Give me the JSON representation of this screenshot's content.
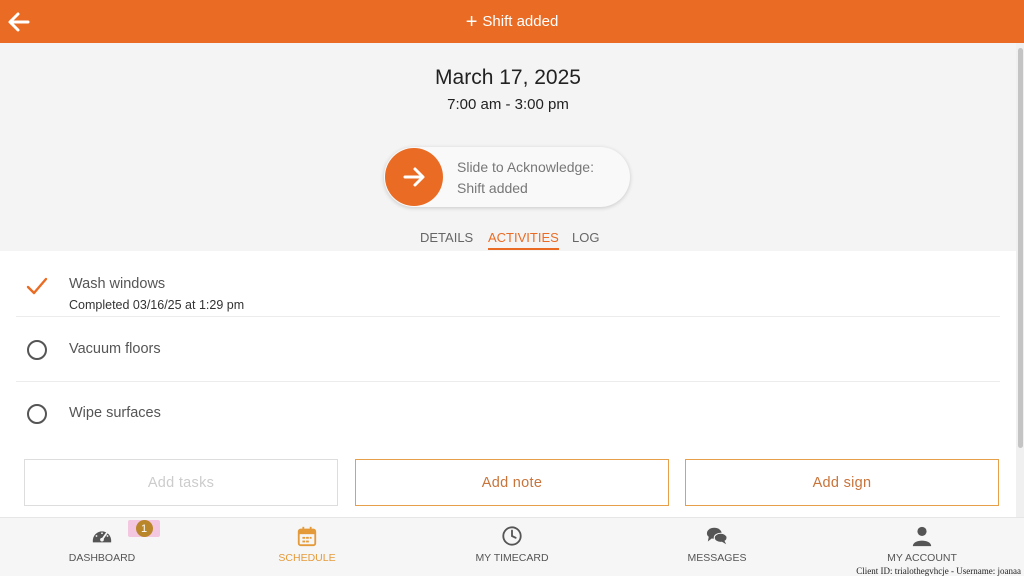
{
  "header": {
    "title": "Shift added",
    "plus_glyph": "+",
    "back_icon": "arrow-left-icon"
  },
  "shift": {
    "date": "March 17, 2025",
    "time": "7:00 am - 3:00 pm"
  },
  "slider": {
    "line1": "Slide to Acknowledge:",
    "line2": "Shift added",
    "icon": "arrow-right-icon"
  },
  "tabs": [
    {
      "label": "DETAILS",
      "active": false
    },
    {
      "label": "ACTIVITIES",
      "active": true
    },
    {
      "label": "LOG",
      "active": false
    }
  ],
  "activities": [
    {
      "title": "Wash windows",
      "subtitle": "Completed 03/16/25 at 1:29 pm",
      "done": true,
      "icon": "checkmark-icon"
    },
    {
      "title": "Vacuum floors",
      "subtitle": "",
      "done": false,
      "icon": "radio-circle-icon"
    },
    {
      "title": "Wipe surfaces",
      "subtitle": "",
      "done": false,
      "icon": "radio-circle-icon"
    }
  ],
  "buttons": {
    "add_tasks": "Add tasks",
    "add_note": "Add note",
    "add_sign": "Add sign"
  },
  "nav": [
    {
      "label": "DASHBOARD",
      "icon": "speedometer-icon",
      "active": false
    },
    {
      "label": "SCHEDULE",
      "icon": "calendar-icon",
      "active": true
    },
    {
      "label": "MY TIMECARD",
      "icon": "clock-icon",
      "active": false
    },
    {
      "label": "MESSAGES",
      "icon": "chat-bubbles-icon",
      "active": false
    },
    {
      "label": "MY ACCOUNT",
      "icon": "user-icon",
      "active": false
    }
  ],
  "badge": {
    "count": "1"
  },
  "footer": {
    "client_id": "Client ID: trialothegvhcje - Username: joanaa"
  },
  "colors": {
    "brand_orange": "#ea6c24",
    "button_border": "#e6a04a",
    "button_text": "#c8743a",
    "nav_active": "#e59a3a",
    "badge_fill": "#b9862a"
  }
}
